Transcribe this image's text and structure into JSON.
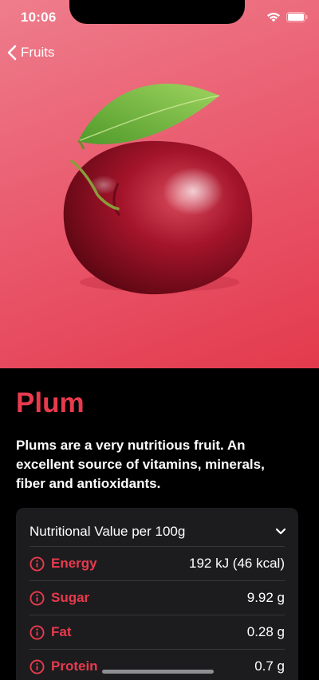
{
  "status": {
    "time": "10:06"
  },
  "nav": {
    "back_label": "Fruits"
  },
  "fruit": {
    "name": "Plum",
    "description": "Plums are a very nutritious fruit. An excellent source of vitamins, minerals, fiber and antioxidants.",
    "image_icon": "plum-image",
    "gradient_colors": [
      "#ee7d8c",
      "#e33a4d"
    ]
  },
  "nutrition": {
    "header": "Nutritional Value per 100g",
    "rows": [
      {
        "label": "Energy",
        "value": "192 kJ (46 kcal)"
      },
      {
        "label": "Sugar",
        "value": "9.92 g"
      },
      {
        "label": "Fat",
        "value": "0.28 g"
      },
      {
        "label": "Protein",
        "value": "0.7 g"
      }
    ]
  },
  "colors": {
    "accent": "#e83a4e",
    "card": "#1c1c1e",
    "background": "#000000"
  }
}
